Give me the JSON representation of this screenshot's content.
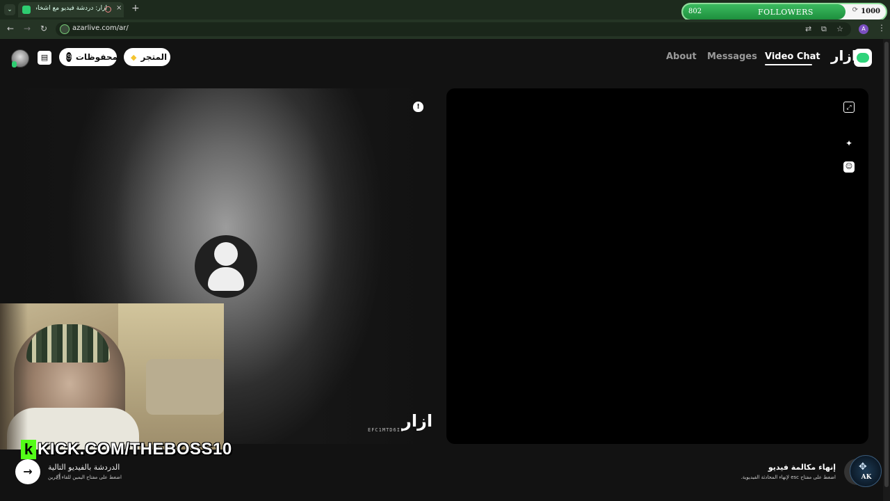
{
  "browser": {
    "tab": {
      "title": "أزار: دردشة فيديو مع أشخاص",
      "close_glyph": "×"
    },
    "new_tab_glyph": "+",
    "url": "azarlive.com/ar/",
    "profile_initial": "A"
  },
  "followers_widget": {
    "count": "802",
    "label": "FOLLOWERS",
    "goal": "1000",
    "progress": 0.802
  },
  "header": {
    "saved_label": "المحفوظات",
    "store_label": "المتجر",
    "nav": {
      "about": "About",
      "messages": "Messages",
      "video_chat": "Video Chat"
    },
    "brand_name": "ازار"
  },
  "remote_panel": {
    "watermark_code": "EFC1MTD6I1",
    "watermark_brand": "ازار"
  },
  "stream_overlay": {
    "kick_logo": "k",
    "kick_url": "KICK.COM/THEBOSS10"
  },
  "controls": {
    "next_title": "الدردشة بالفيديو التالية",
    "next_hint": "اضغط على مفتاح اليمين للقاء آخرين",
    "end_title": "إنهاء مكالمة فيديو",
    "end_hint": "اضغط على مفتاح esc لإنهاء المحادثة الفيديوية.",
    "ak_logo_text": "AK"
  },
  "colors": {
    "accent_green": "#2ed37a",
    "kick_green": "#53fc18",
    "followers_fill": "#2a9f4c"
  },
  "icons": {
    "expand": "expand-icon",
    "effects": "magic-wand-icon",
    "sticker": "sticker-icon",
    "report": "report-icon",
    "next": "arrow-right-icon"
  }
}
